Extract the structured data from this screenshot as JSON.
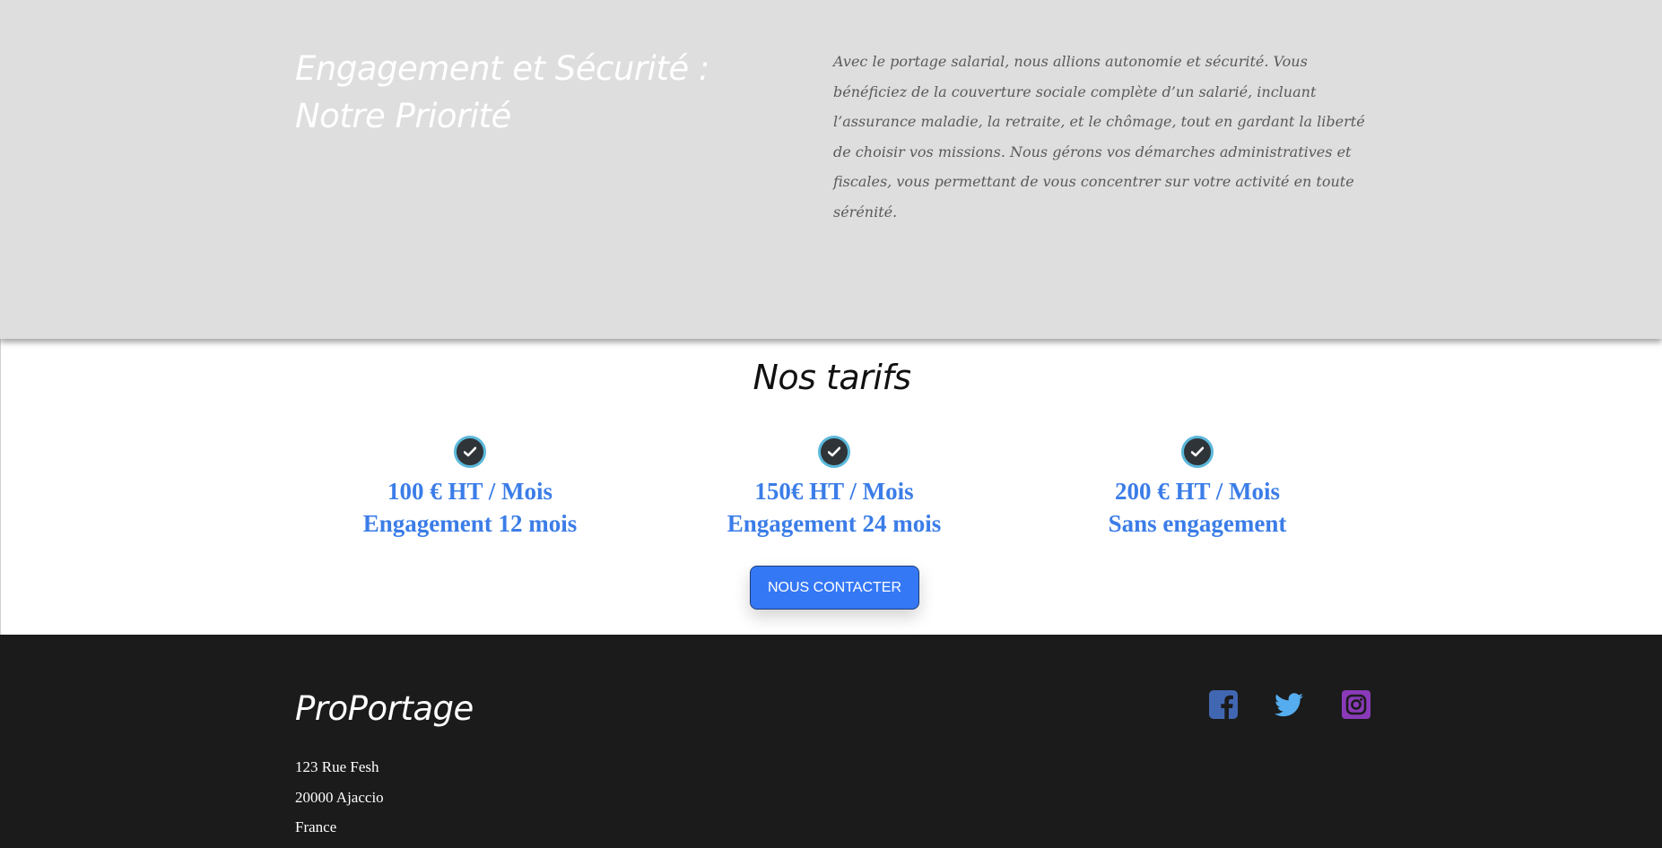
{
  "engagement": {
    "title": "Engagement et Sécurité : Notre Priorité",
    "text": "Avec le portage salarial, nous allions autonomie et sécurité. Vous bénéficiez de la couverture sociale complète d’un salarié, incluant l’assurance maladie, la retraite, et le chômage, tout en gardant la liberté de choisir vos missions. Nous gérons vos démarches administratives et fiscales, vous permettant de vous concentrer sur votre activité en toute sérénité."
  },
  "tarifs": {
    "title": "Nos tarifs",
    "plans": [
      {
        "icon": "check-circle-icon",
        "price": "100 € HT / Mois",
        "term": "Engagement 12 mois"
      },
      {
        "icon": "check-circle-icon",
        "price": "150€ HT / Mois",
        "term": "Engagement 24 mois"
      },
      {
        "icon": "check-circle-icon",
        "price": "200 € HT / Mois",
        "term": "Sans engagement"
      }
    ],
    "contact_button": "NOUS CONTACTER"
  },
  "footer": {
    "brand": "ProPortage",
    "address": [
      "123 Rue Fesh",
      "20000 Ajaccio",
      "France"
    ],
    "social": [
      {
        "icon": "facebook-icon",
        "color": "#4267b2"
      },
      {
        "icon": "twitter-icon",
        "color": "#55acee"
      },
      {
        "icon": "instagram-icon",
        "color": "#8a3ab9"
      }
    ]
  },
  "colors": {
    "accent": "#3b7de8",
    "button": "#3578f6",
    "section_bg": "#dedede",
    "footer_bg": "#1b1b1b"
  }
}
